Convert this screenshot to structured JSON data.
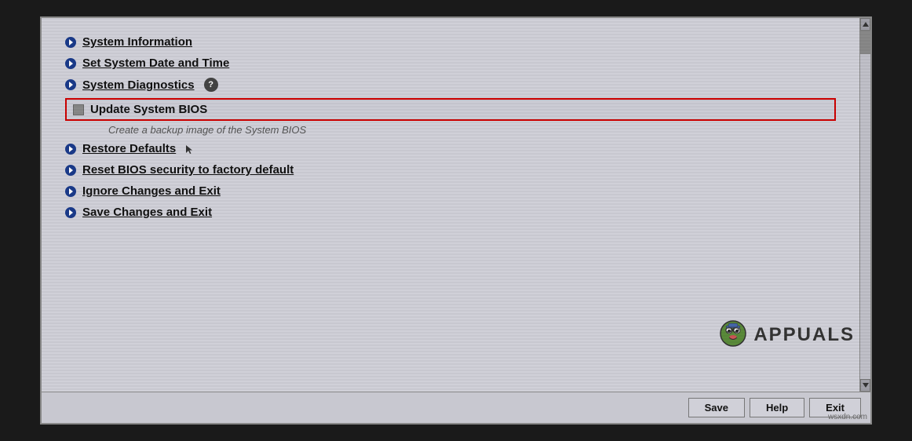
{
  "bios": {
    "menu_items": [
      {
        "id": "system-information",
        "label": "System Information",
        "type": "bullet",
        "highlighted": false
      },
      {
        "id": "set-system-date",
        "label": "Set System Date and Time",
        "type": "bullet",
        "highlighted": false
      },
      {
        "id": "system-diagnostics",
        "label": "System Diagnostics",
        "type": "bullet",
        "has_help": true,
        "highlighted": false
      },
      {
        "id": "update-system-bios",
        "label": "Update System BIOS",
        "type": "highlight-box",
        "highlighted": true
      },
      {
        "id": "restore-defaults",
        "label": "Restore Defaults",
        "type": "bullet",
        "highlighted": false
      },
      {
        "id": "reset-bios-security",
        "label": "Reset BIOS security to factory default",
        "type": "bullet",
        "highlighted": false
      },
      {
        "id": "ignore-changes",
        "label": "Ignore Changes and Exit",
        "type": "bullet",
        "highlighted": false
      },
      {
        "id": "save-changes",
        "label": "Save Changes and Exit",
        "type": "bullet",
        "highlighted": false
      }
    ],
    "sub_text": "Create a backup image of the System BIOS",
    "buttons": [
      {
        "id": "save-btn",
        "label": "Save"
      },
      {
        "id": "help-btn",
        "label": "Help"
      },
      {
        "id": "exit-btn",
        "label": "Exit"
      }
    ],
    "watermark_text": "APPUALS",
    "source_text": "wsxdn.com"
  }
}
